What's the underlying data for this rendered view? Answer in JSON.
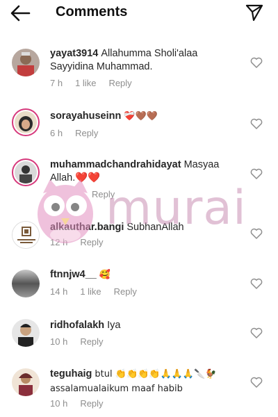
{
  "header": {
    "title": "Comments"
  },
  "comments": [
    {
      "username": "yayat3914",
      "text": "Allahumma Sholi'alaa Sayyidina Muhammad.",
      "time": "7 h",
      "likes": "1 like",
      "reply": "Reply"
    },
    {
      "username": "sorayahuseinn",
      "text": "❤️‍🩹🤎🤎",
      "time": "6 h",
      "likes": "",
      "reply": "Reply"
    },
    {
      "username": "muhammadchandrahidayat",
      "text": "Masyaa Allah.❤️❤️",
      "time": "",
      "likes": "",
      "reply": "Reply"
    },
    {
      "username": "alkauthar.bangi",
      "text": "SubhanAllah",
      "time": "12 h",
      "likes": "",
      "reply": "Reply"
    },
    {
      "username": "ftnnjw4__",
      "text": "🥰",
      "time": "14 h",
      "likes": "1 like",
      "reply": "Reply"
    },
    {
      "username": "ridhofalakh",
      "text": "Iya",
      "time": "10 h",
      "likes": "",
      "reply": "Reply"
    },
    {
      "username": "teguhaig",
      "text": "btul 👏👏👏👏🙏🙏🙏🔪🐓 assalamualaikum maaf habib",
      "time": "10 h",
      "likes": "",
      "reply": "Reply"
    }
  ],
  "watermark": {
    "text": "murai"
  },
  "icons": {
    "back": "arrow-left-icon",
    "send": "send-icon",
    "like": "heart-outline-icon"
  },
  "colors": {
    "story_ring": "#d6397c",
    "meta": "#8e8e8e",
    "text": "#262626"
  }
}
